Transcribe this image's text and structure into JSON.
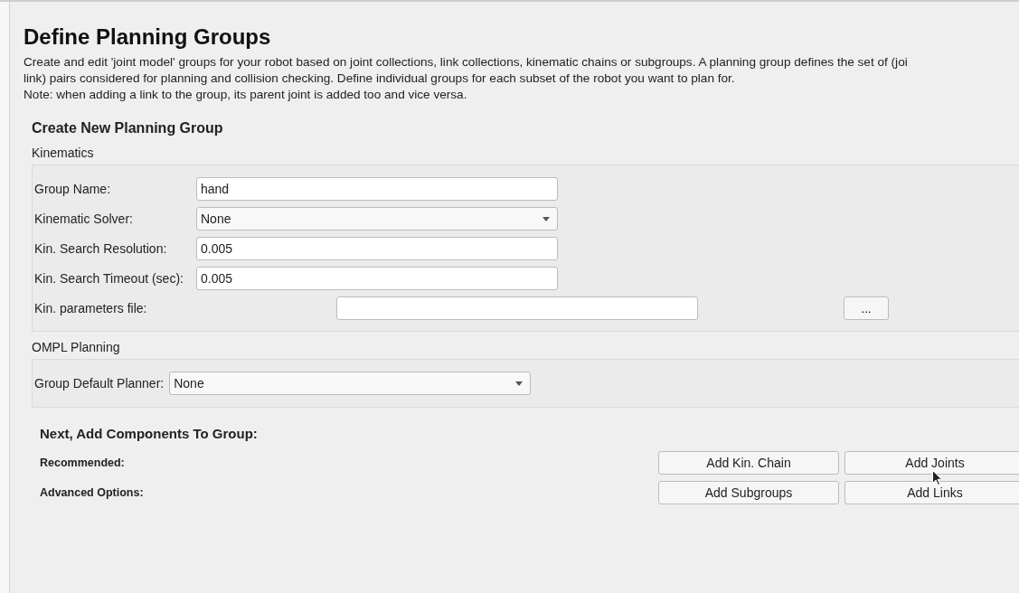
{
  "page": {
    "title": "Define Planning Groups",
    "description_lines": [
      "Create and edit 'joint model' groups for your robot based on joint collections, link collections, kinematic chains or subgroups. A planning group defines the set of (joi",
      "link) pairs considered for planning and collision checking. Define individual groups for each subset of the robot you want to plan for.",
      "Note: when adding a link to the group, its parent joint is added too and vice versa."
    ]
  },
  "create_group": {
    "heading": "Create New Planning Group",
    "kinematics": {
      "heading": "Kinematics",
      "fields": [
        {
          "label": "Group Name:",
          "kind": "text",
          "value": "hand"
        },
        {
          "label": "Kinematic Solver:",
          "kind": "dropdown",
          "value": "None"
        },
        {
          "label": "Kin. Search Resolution:",
          "kind": "text",
          "value": "0.005"
        },
        {
          "label": "Kin. Search Timeout (sec):",
          "kind": "text",
          "value": "0.005"
        },
        {
          "label": "Kin. parameters file:",
          "kind": "file",
          "browse": "..."
        }
      ]
    },
    "ompl": {
      "heading": "OMPL Planning",
      "fields": [
        {
          "label": "Group Default Planner:",
          "kind": "dropdown",
          "value": "None"
        }
      ]
    }
  },
  "components": {
    "heading": "Next, Add Components To Group:",
    "rows": [
      {
        "label": "Recommended:",
        "buttons": [
          "Add Kin. Chain",
          "Add Joints"
        ]
      },
      {
        "label": "Advanced Options:",
        "buttons": [
          "Add Subgroups",
          "Add Links"
        ]
      }
    ]
  }
}
